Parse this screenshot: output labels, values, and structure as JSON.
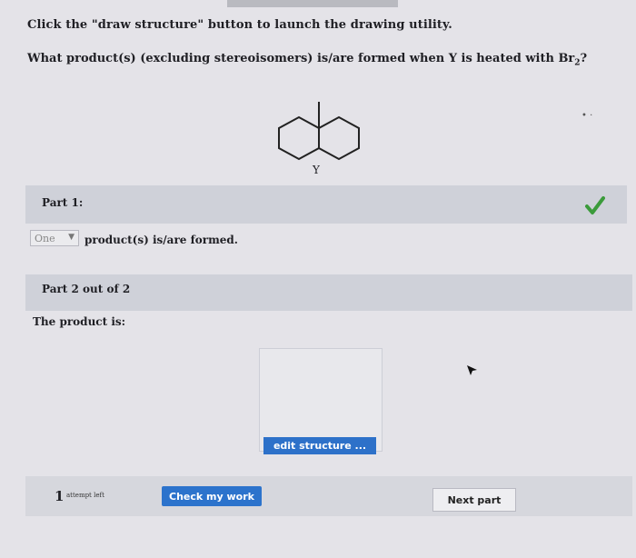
{
  "instructions": "Click the \"draw structure\" button to launch the drawing utility.",
  "question": {
    "prefix": "What product(s) (excluding stereoisomers) is/are formed when Y is heated with Br",
    "subscript": "2",
    "suffix": "?"
  },
  "molecule_label": "Y",
  "part1": {
    "label": "Part 1:",
    "dropdown_value": "One",
    "after_text": "product(s) is/are formed.",
    "status_icon": "check-icon",
    "status_color": "#3b9b3b"
  },
  "part2": {
    "label": "Part 2 out of 2",
    "prompt": "The product is:",
    "edit_button": "edit structure ..."
  },
  "footer": {
    "attempts_number": "1",
    "attempts_text": "attempt left",
    "check_button": "Check my work",
    "next_button": "Next part"
  },
  "colors": {
    "accent": "#2c73cc",
    "band": "#cfd1d9"
  }
}
